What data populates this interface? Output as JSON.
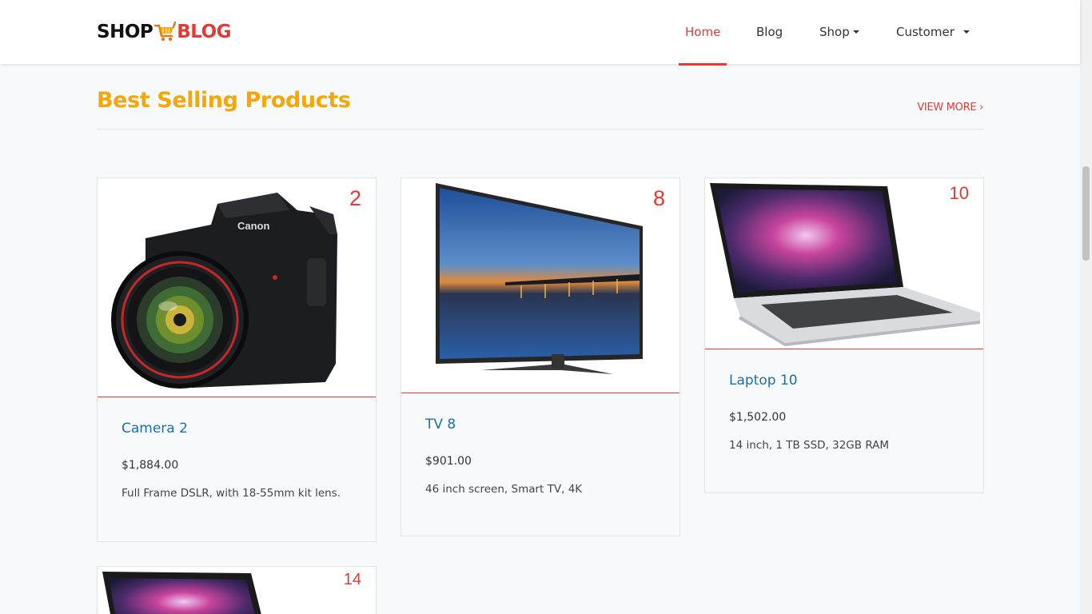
{
  "brand": {
    "part1": "SHOP",
    "part2": "BLOG"
  },
  "nav": {
    "home": "Home",
    "blog": "Blog",
    "shop": "Shop",
    "customer": "Customer"
  },
  "section": {
    "title": "Best Selling Products",
    "view_more": "VIEW MORE ›"
  },
  "products": [
    {
      "badge": "2",
      "name": "Camera 2",
      "price": "$1,884.00",
      "desc": "Full Frame DSLR, with 18-55mm kit lens.",
      "icon": "camera-image"
    },
    {
      "badge": "8",
      "name": "TV 8",
      "price": "$901.00",
      "desc": "46 inch screen, Smart TV, 4K",
      "icon": "tv-image"
    },
    {
      "badge": "10",
      "name": "Laptop 10",
      "price": "$1,502.00",
      "desc": "14 inch, 1 TB SSD, 32GB RAM",
      "icon": "laptop-image"
    },
    {
      "badge": "14",
      "icon": "laptop-image"
    }
  ],
  "colors": {
    "accent": "#e53935",
    "title": "#f5a60b",
    "link": "#1a6fb0"
  }
}
